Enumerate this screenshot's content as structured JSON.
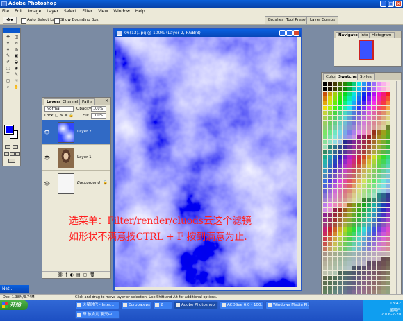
{
  "app": {
    "title": "Adobe Photoshop"
  },
  "menu": [
    "File",
    "Edit",
    "Image",
    "Layer",
    "Select",
    "Filter",
    "View",
    "Window",
    "Help"
  ],
  "options": {
    "auto_select": "Auto Select Layer",
    "bounding_box": "Show Bounding Box",
    "wells": [
      "Brushes",
      "Tool Presets",
      "Layer Comps"
    ]
  },
  "toolbox": {
    "fg_color": "#0000ff",
    "bg_color": "#ffffff",
    "tool_glyphs": [
      "✥",
      "◫",
      "⌖",
      "✂",
      "⌗",
      "◍",
      "✎",
      "▣",
      "✐",
      "◒",
      "⬚",
      "◉",
      "T",
      "✎",
      "◻",
      "☜",
      "⌕",
      "✋"
    ]
  },
  "layers": {
    "tabs": [
      "Layers",
      "Channels",
      "Paths"
    ],
    "blend_mode": "Normal",
    "opacity_label": "Opacity:",
    "opacity": "100%",
    "lock_label": "Lock:",
    "fill_label": "Fill:",
    "fill": "100%",
    "items": [
      {
        "name": "Layer 2"
      },
      {
        "name": "Layer 1"
      },
      {
        "name": "Background"
      }
    ]
  },
  "document": {
    "title": "06(13).jpg @ 100% (Layer 2, RGB/8)"
  },
  "navigator": {
    "tabs": [
      "Navigator",
      "Info",
      "Histogram"
    ]
  },
  "swatches": {
    "tabs": [
      "Color",
      "Swatches",
      "Styles"
    ]
  },
  "annotation": {
    "line1": "选菜单：Filter/render/cluods云这个滤镜",
    "line2": "如形状不满意按CTRL + F 按到满意为止.",
    "color": "#ff2020"
  },
  "statusbar": {
    "doc": "Doc: 1.38M/3.74M",
    "hint": "Click and drag to move layer or selection.  Use Shift and Alt for additional options."
  },
  "mini_window": {
    "title": "Net..."
  },
  "taskbar": {
    "start": "开始",
    "buttons_row1": [
      "火星时代 - Inter...",
      "Europa.eps",
      "2",
      "Adobe Photoshop",
      "ACDSee 6.0 - 100...",
      "Windows Media Pl..."
    ],
    "buttons_row2": [
      "母  放合儿 聊天中"
    ],
    "time": "18:42",
    "weekday": "星期日",
    "date": "2006-2-20"
  }
}
